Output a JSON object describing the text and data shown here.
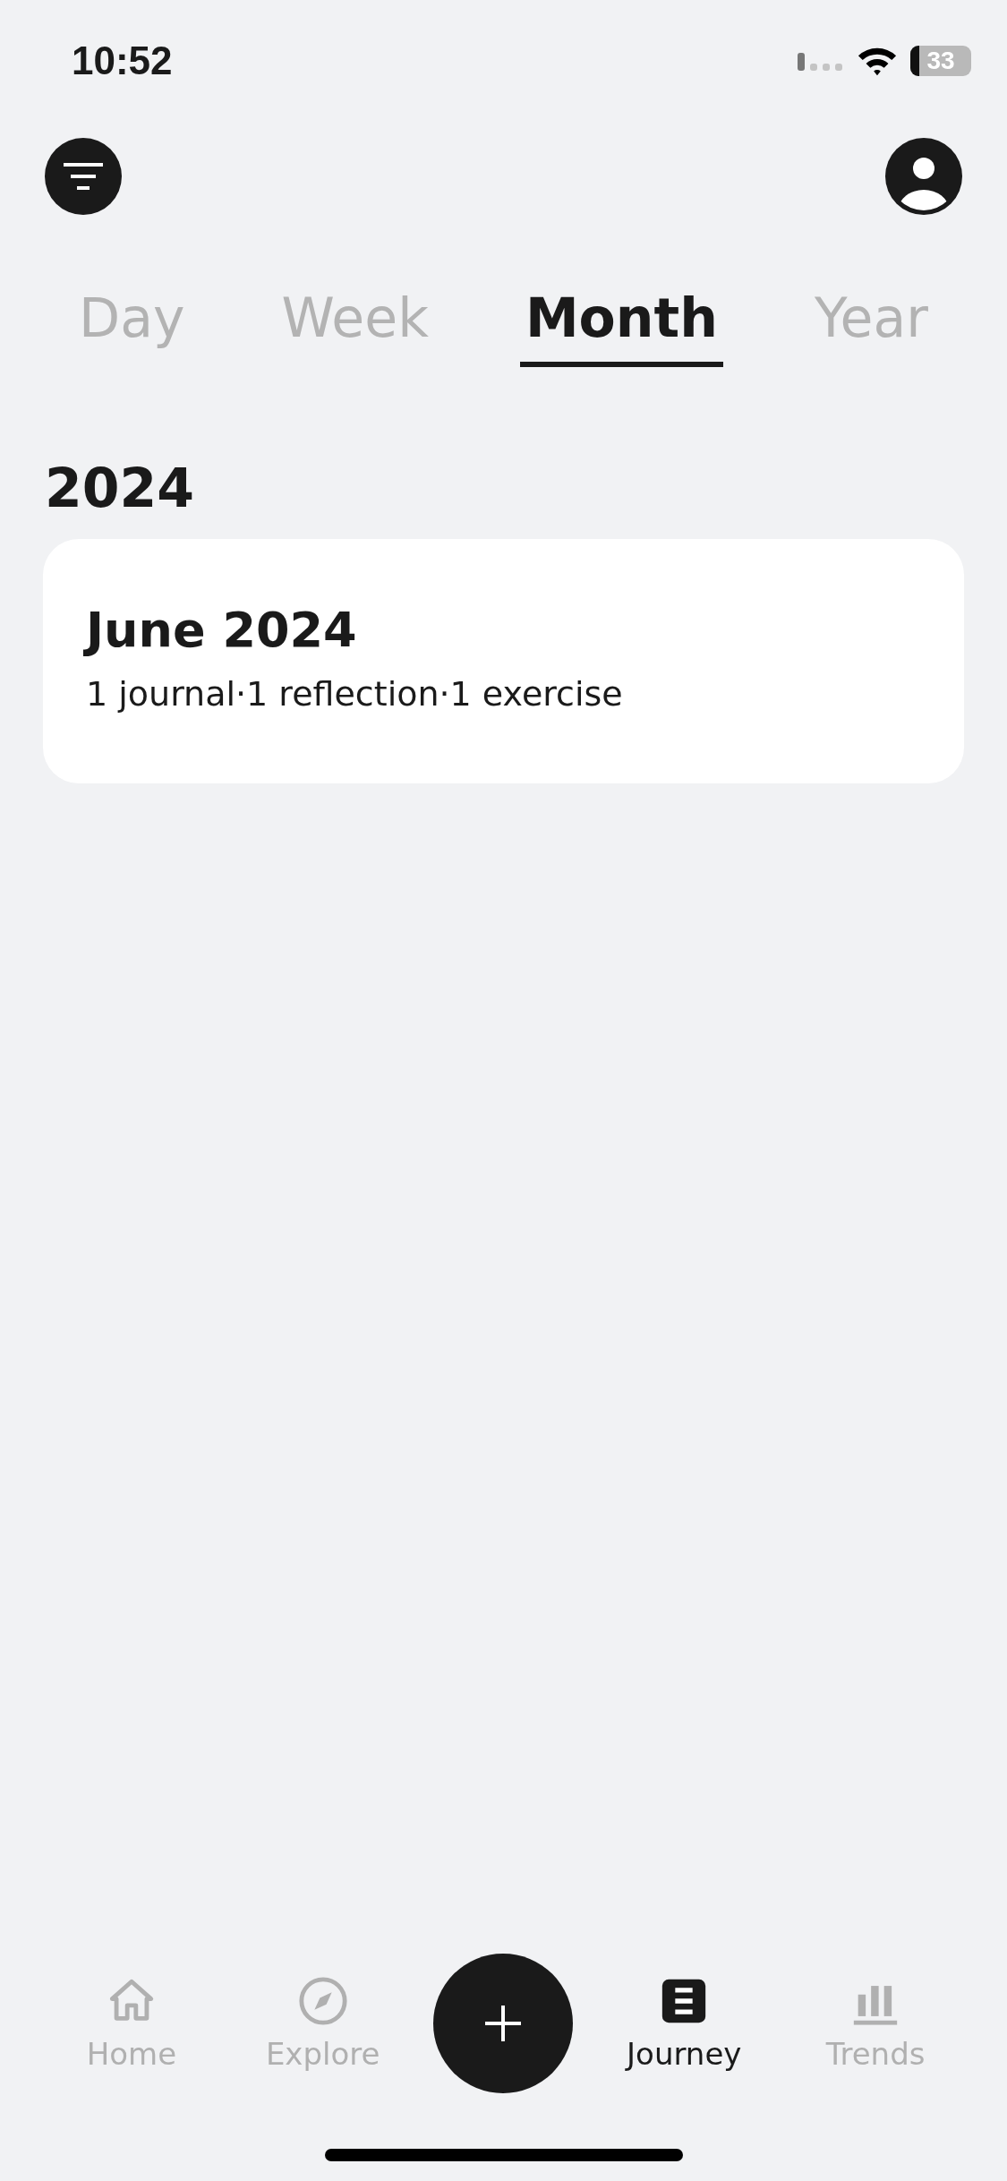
{
  "status_bar": {
    "time": "10:52",
    "battery": "33"
  },
  "period_tabs": [
    {
      "label": "Day",
      "selected": false
    },
    {
      "label": "Week",
      "selected": false
    },
    {
      "label": "Month",
      "selected": true
    },
    {
      "label": "Year",
      "selected": false
    }
  ],
  "sections": [
    {
      "title": "2024",
      "entries": [
        {
          "title": "June 2024",
          "summary": "1 journal·1 reflection·1 exercise"
        }
      ]
    }
  ],
  "bottom_nav": [
    {
      "kind": "home",
      "label": "Home",
      "selected": false
    },
    {
      "kind": "explore",
      "label": "Explore",
      "selected": false
    },
    {
      "kind": "add"
    },
    {
      "kind": "journey",
      "label": "Journey",
      "selected": true
    },
    {
      "kind": "trends",
      "label": "Trends",
      "selected": false
    }
  ]
}
